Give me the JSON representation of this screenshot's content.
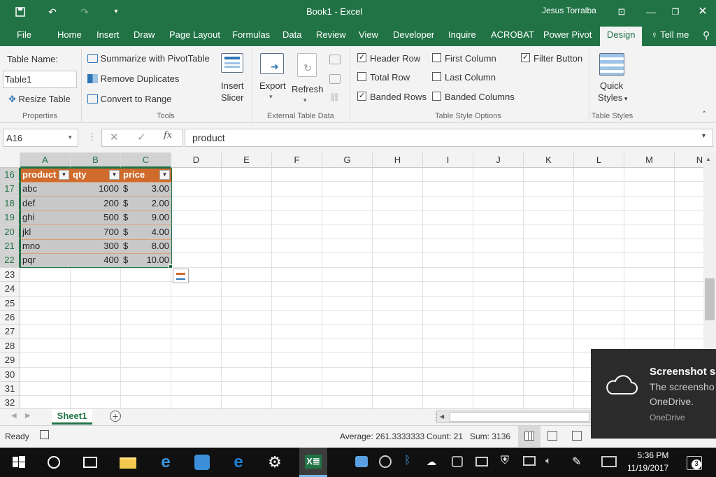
{
  "titlebar": {
    "title": "Book1  -  Excel",
    "user": "Jesus Torralba"
  },
  "tabs": [
    "File",
    "Home",
    "Insert",
    "Draw",
    "Page Layout",
    "Formulas",
    "Data",
    "Review",
    "View",
    "Developer",
    "Inquire",
    "ACROBAT",
    "Power Pivot",
    "Design"
  ],
  "tell_me": "Tell me",
  "ribbon": {
    "table_name_label": "Table Name:",
    "table_name_value": "Table1",
    "resize_table": "Resize Table",
    "properties": "Properties",
    "summarize": "Summarize with PivotTable",
    "remove_duplicates": "Remove Duplicates",
    "convert_to_range": "Convert to Range",
    "tools": "Tools",
    "insert_slicer_1": "Insert",
    "insert_slicer_2": "Slicer",
    "export": "Export",
    "refresh": "Refresh",
    "external": "External Table Data",
    "header_row": "Header Row",
    "total_row": "Total Row",
    "banded_rows": "Banded Rows",
    "first_column": "First Column",
    "last_column": "Last Column",
    "banded_columns": "Banded Columns",
    "filter_button": "Filter Button",
    "style_options": "Table Style Options",
    "quick_1": "Quick",
    "quick_2": "Styles",
    "table_styles": "Table Styles",
    "checks": {
      "header_row": true,
      "total_row": false,
      "banded_rows": true,
      "first_column": false,
      "last_column": false,
      "banded_columns": false,
      "filter_button": true
    }
  },
  "formula_bar": {
    "name_box": "A16",
    "fx": "fx",
    "content": "product"
  },
  "columns": [
    "A",
    "B",
    "C",
    "D",
    "E",
    "F",
    "G",
    "H",
    "I",
    "J",
    "K",
    "L",
    "M",
    "N"
  ],
  "rows": [
    "16",
    "17",
    "18",
    "19",
    "20",
    "21",
    "22",
    "23",
    "24",
    "25",
    "26",
    "27",
    "28",
    "29",
    "30",
    "31",
    "32"
  ],
  "table": {
    "headers": [
      "product",
      "qty",
      "price"
    ],
    "data": [
      [
        "abc",
        "1000",
        "$",
        "3.00"
      ],
      [
        "def",
        "200",
        "$",
        "2.00"
      ],
      [
        "ghi",
        "500",
        "$",
        "9.00"
      ],
      [
        "jkl",
        "700",
        "$",
        "4.00"
      ],
      [
        "mno",
        "300",
        "$",
        "8.00"
      ],
      [
        "pqr",
        "400",
        "$",
        "10.00"
      ]
    ]
  },
  "sheet_tab": "Sheet1",
  "status": {
    "ready": "Ready",
    "average": "Average: 261.3333333",
    "count": "Count: 21",
    "sum": "Sum: 3136"
  },
  "toast": {
    "title": "Screenshot sa",
    "line1": "The screensho",
    "line2": "OneDrive.",
    "source": "OneDrive"
  },
  "clock": {
    "time": "5:36 PM",
    "date": "11/19/2017",
    "badge": "3"
  },
  "colors": {
    "excel_green": "#217346",
    "table_header": "#d06b2c",
    "table_band": "#c8c8c8"
  }
}
